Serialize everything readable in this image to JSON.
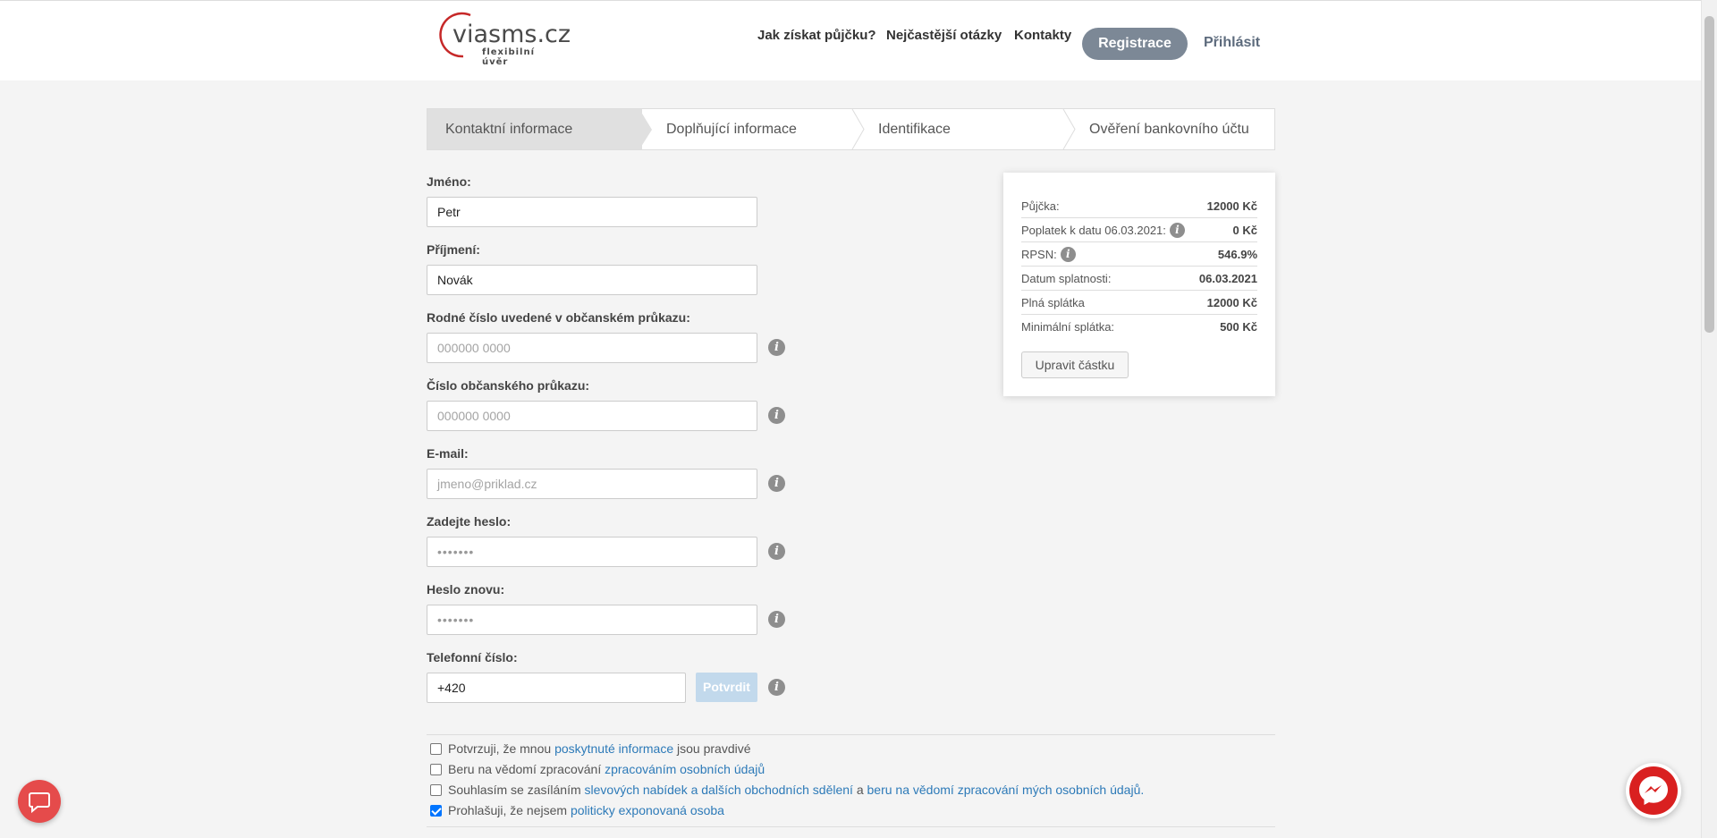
{
  "header": {
    "brand": "viasms.cz",
    "tagline": "flexibilní úvěr",
    "nav": [
      "Jak získat půjčku?",
      "Nejčastější otázky",
      "Kontakty"
    ],
    "register_label": "Registrace",
    "login_label": "Přihlásit"
  },
  "steps": [
    "Kontaktní informace",
    "Doplňující informace",
    "Identifikace",
    "Ověření bankovního účtu"
  ],
  "form": {
    "first_name": {
      "label": "Jméno:",
      "value": "Petr"
    },
    "last_name": {
      "label": "Příjmení:",
      "value": "Novák"
    },
    "birth_number": {
      "label": "Rodné číslo uvedené v občanském průkazu:",
      "placeholder": "000000 0000"
    },
    "id_number": {
      "label": "Číslo občanského průkazu:",
      "placeholder": "000000 0000"
    },
    "email": {
      "label": "E-mail:",
      "placeholder": "jmeno@priklad.cz"
    },
    "password": {
      "label": "Zadejte heslo:",
      "placeholder": "•••••••"
    },
    "password_again": {
      "label": "Heslo znovu:",
      "placeholder": "•••••••"
    },
    "phone": {
      "label": "Telefonní číslo:",
      "value": "+420"
    },
    "confirm_label": "Potvrdit"
  },
  "summary": {
    "rows": [
      {
        "label": "Půjčka:",
        "value": "12000 Kč"
      },
      {
        "label": "Poplatek k datu 06.03.2021:",
        "value": "0 Kč"
      },
      {
        "label": "RPSN:",
        "value": "546.9%"
      },
      {
        "label": "Datum splatnosti:",
        "value": "06.03.2021"
      },
      {
        "label": "Plná splátka",
        "value": "12000 Kč"
      },
      {
        "label": "Minimální splátka:",
        "value": "500 Kč"
      }
    ],
    "adjust_label": "Upravit částku"
  },
  "consents": [
    {
      "checked": false,
      "pre": "Potvrzuji, že mnou ",
      "link": "poskytnuté informace",
      "post": " jsou pravdivé",
      "link2": "",
      "mid": ""
    },
    {
      "checked": false,
      "pre": "Beru na vědomí zpracování ",
      "link": "zpracováním osobních údajů",
      "post": "",
      "link2": "",
      "mid": ""
    },
    {
      "checked": false,
      "pre": "Souhlasím se zasíláním ",
      "link": "slevových nabídek a dalších obchodních sdělení",
      "mid": " a ",
      "link2": "beru na vědomí zpracování mých osobních údajů.",
      "post": ""
    },
    {
      "checked": true,
      "pre": "Prohlašuji, že nejsem ",
      "link": "politicky exponovaná osoba",
      "post": "",
      "link2": "",
      "mid": ""
    }
  ],
  "icons": {
    "info": "info-icon",
    "chat": "chat-icon",
    "messenger": "messenger-icon"
  },
  "colors": {
    "accent": "#e54b4b",
    "link": "#2d7ab8",
    "register": "#7c8896"
  }
}
